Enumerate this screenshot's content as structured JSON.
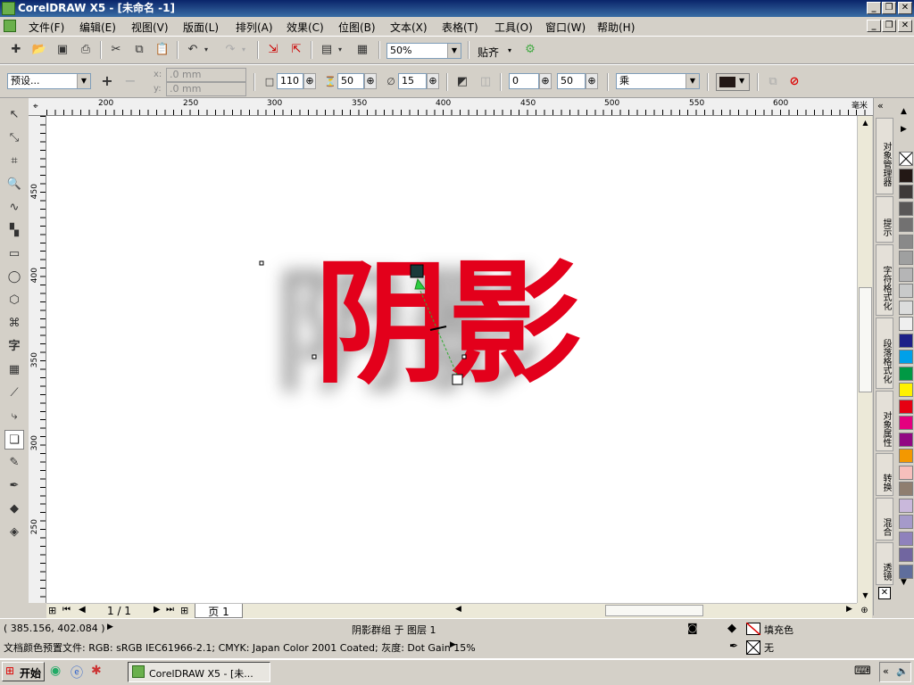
{
  "window": {
    "title": "CorelDRAW X5 - [未命名 -1]"
  },
  "menu": [
    "文件(F)",
    "编辑(E)",
    "视图(V)",
    "版面(L)",
    "排列(A)",
    "效果(C)",
    "位图(B)",
    "文本(X)",
    "表格(T)",
    "工具(O)",
    "窗口(W)",
    "帮助(H)"
  ],
  "standard_toolbar": {
    "zoom_level": "50%",
    "snap_label": "贴齐"
  },
  "property_bar": {
    "preset": "预设...",
    "x_value": ".0 mm",
    "y_value": ".0 mm",
    "x_label": "x:",
    "y_label": "y:",
    "opacity": "110",
    "feather": "50",
    "feather_dir": "15",
    "fade": "0",
    "stretch": "50",
    "merge_mode": "乘"
  },
  "ruler": {
    "h_ticks": [
      "200",
      "250",
      "300",
      "350",
      "400",
      "450",
      "500",
      "550",
      "600"
    ],
    "h_unit": "毫米",
    "v_ticks": [
      "450",
      "400",
      "350",
      "300",
      "250"
    ]
  },
  "canvas": {
    "artwork_text": "阴影",
    "text_color": "#e3001b"
  },
  "page_nav": {
    "page_count": "1 / 1",
    "page_tab": "页 1"
  },
  "dockers": [
    "对象管理器",
    "提示",
    "字符格式化",
    "段落格式化",
    "对象属性",
    "转换",
    "混合",
    "透镜"
  ],
  "palette": [
    "#ffffff",
    "#231815",
    "#3e3a39",
    "#595757",
    "#727171",
    "#898989",
    "#9fa0a0",
    "#b5b5b6",
    "#c9caca",
    "#dcdddd",
    "#efefef",
    "#1d2088",
    "#00a0e9",
    "#009944",
    "#fff100",
    "#e60012",
    "#e4007f",
    "#920783",
    "#f39800",
    "#f6bfbc",
    "#8f7e6f",
    "#c9b8db",
    "#a59aca",
    "#8f82bc",
    "#7166a0",
    "#5f6e9c"
  ],
  "status": {
    "coords": "( 385.156, 402.084 )",
    "selection": "阴影群组 于 图层 1",
    "fill_label": "填充色",
    "outline_label": "无",
    "color_profile": "文档颜色预置文件: RGB: sRGB IEC61966-2.1; CMYK: Japan Color 2001 Coated; 灰度: Dot Gain 15%"
  },
  "taskbar": {
    "start": "开始",
    "task": "CorelDRAW X5 - [未..."
  }
}
